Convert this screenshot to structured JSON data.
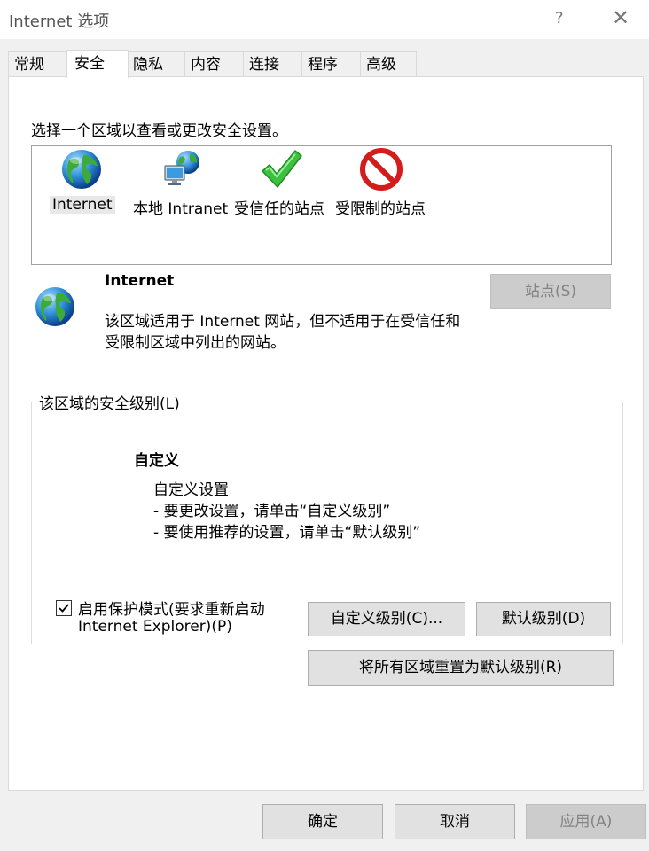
{
  "window": {
    "title": "Internet 选项",
    "help": "?",
    "close": "✕"
  },
  "tabs": [
    {
      "label": "常规"
    },
    {
      "label": "安全"
    },
    {
      "label": "隐私"
    },
    {
      "label": "内容"
    },
    {
      "label": "连接"
    },
    {
      "label": "程序"
    },
    {
      "label": "高级"
    }
  ],
  "active_tab": "安全",
  "zones": {
    "prompt": "选择一个区域以查看或更改安全设置。",
    "items": [
      {
        "label": "Internet",
        "icon": "globe-icon",
        "selected": true
      },
      {
        "label": "本地 Intranet",
        "icon": "network-computer-icon",
        "selected": false
      },
      {
        "label": "受信任的站点",
        "icon": "checkmark-icon",
        "selected": false
      },
      {
        "label": "受限制的站点",
        "icon": "prohibited-icon",
        "selected": false
      }
    ]
  },
  "zone_info": {
    "name": "Internet",
    "description_line1": "该区域适用于 Internet 网站，但不适用于在受信任和",
    "description_line2": "受限制区域中列出的网站。",
    "sites_button": "站点(S)"
  },
  "security_level": {
    "group_title": "该区域的安全级别(L)",
    "level_name": "自定义",
    "desc_line1": "自定义设置",
    "desc_line2": "- 要更改设置，请单击“自定义级别”",
    "desc_line3": "- 要使用推荐的设置，请单击“默认级别”",
    "protected_mode_line1": "启用保护模式(要求重新启动",
    "protected_mode_line2": "Internet Explorer)(P)",
    "protected_mode_checked": true,
    "custom_level_button": "自定义级别(C)...",
    "default_level_button": "默认级别(D)"
  },
  "reset_all_button": "将所有区域重置为默认级别(R)",
  "footer": {
    "ok": "确定",
    "cancel": "取消",
    "apply": "应用(A)"
  }
}
